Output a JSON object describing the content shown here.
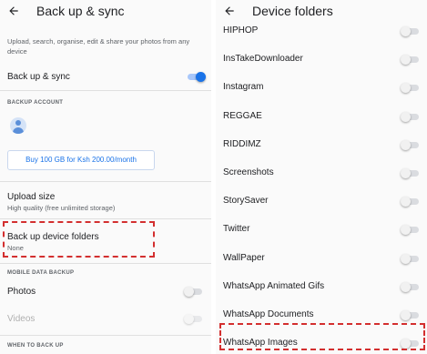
{
  "left": {
    "title": "Back up & sync",
    "description": "Upload, search, organise, edit & share your photos from any device",
    "backup_toggle_label": "Back up & sync",
    "backup_account_header": "BACKUP ACCOUNT",
    "buy_button": "Buy 100 GB for Ksh 200.00/month",
    "upload_size_label": "Upload size",
    "upload_size_value": "High quality (free unlimited storage)",
    "device_folders_label": "Back up device folders",
    "device_folders_value": "None",
    "mobile_data_header": "MOBILE DATA BACKUP",
    "photos_label": "Photos",
    "videos_label": "Videos",
    "when_header": "WHEN TO BACK UP",
    "toggles": {
      "backup_sync": true,
      "photos": false,
      "videos": false
    }
  },
  "right": {
    "title": "Device folders",
    "folders": [
      {
        "name": "HIPHOP",
        "enabled": false
      },
      {
        "name": "InsTakeDownloader",
        "enabled": false
      },
      {
        "name": "Instagram",
        "enabled": false
      },
      {
        "name": "REGGAE",
        "enabled": false
      },
      {
        "name": "RIDDIMZ",
        "enabled": false
      },
      {
        "name": "Screenshots",
        "enabled": false
      },
      {
        "name": "StorySaver",
        "enabled": false
      },
      {
        "name": "Twitter",
        "enabled": false
      },
      {
        "name": "WallPaper",
        "enabled": false
      },
      {
        "name": "WhatsApp Animated Gifs",
        "enabled": false
      },
      {
        "name": "WhatsApp Documents",
        "enabled": false
      },
      {
        "name": "WhatsApp Images",
        "enabled": false
      }
    ]
  },
  "colors": {
    "accent": "#1a73e8",
    "highlight": "#d32f2f",
    "text_primary": "#202124",
    "text_secondary": "#5f6368"
  }
}
